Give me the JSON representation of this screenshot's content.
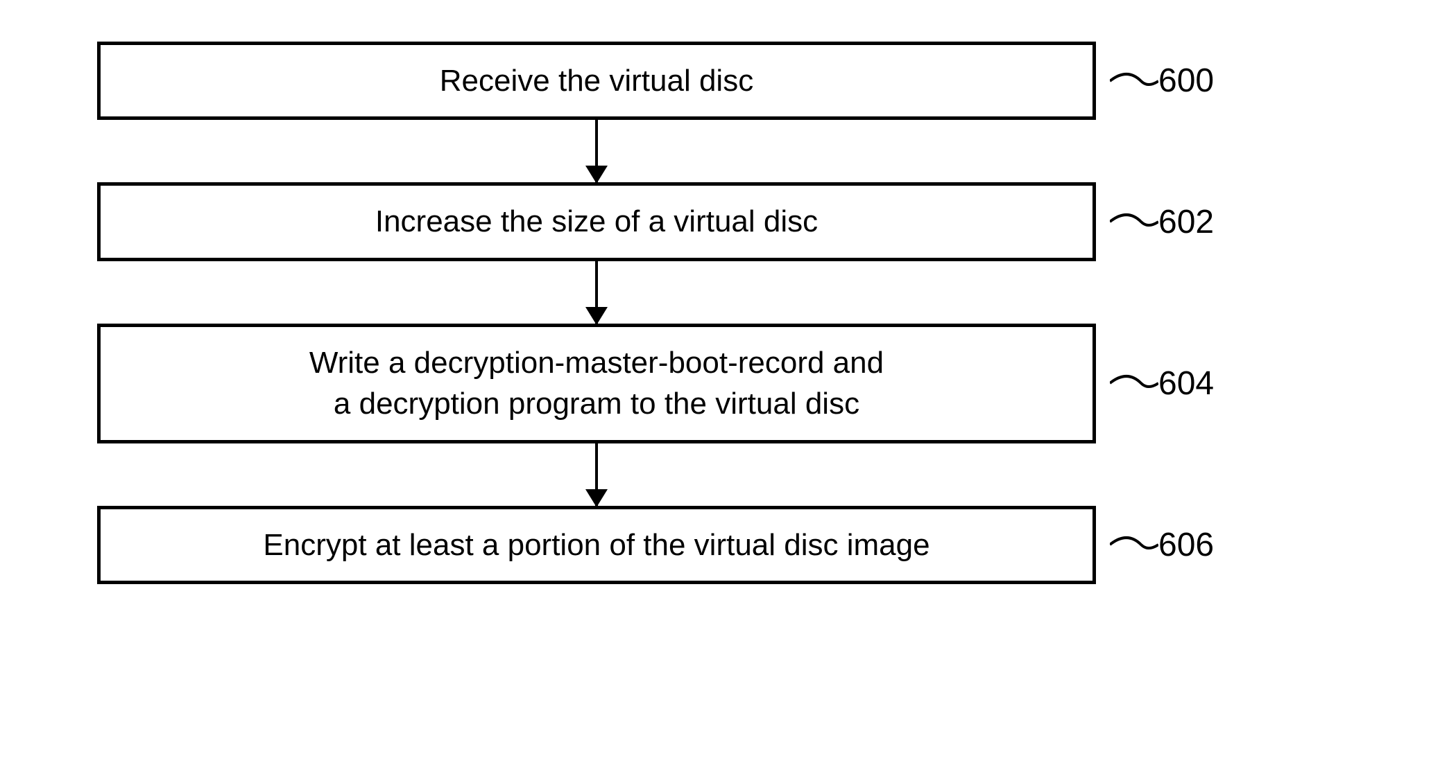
{
  "flow": {
    "steps": [
      {
        "text": "Receive the virtual disc",
        "ref": "600"
      },
      {
        "text": "Increase the size of a virtual disc",
        "ref": "602"
      },
      {
        "text": "Write a decryption-master-boot-record and\na decryption program to the virtual disc",
        "ref": "604"
      },
      {
        "text": "Encrypt at least a portion of the virtual disc image",
        "ref": "606"
      }
    ]
  }
}
